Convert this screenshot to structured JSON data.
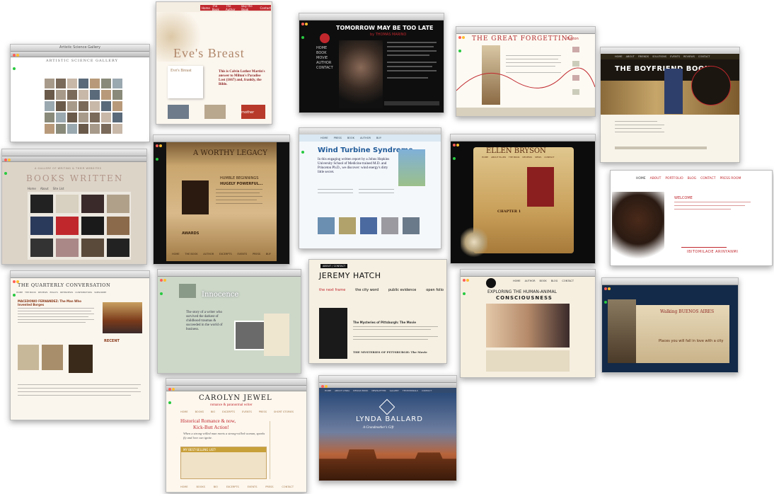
{
  "shots": {
    "s01": {
      "title": "Artistic Science Gallery",
      "heading": "ARTISTIC SCIENCE GALLERY"
    },
    "s02": {
      "brand": "Eve's Breast",
      "book_label": "Eve's Breast",
      "tagline": "This is Calvin Luther Martin's answer to Milton's Paradise Lost (1667) and, frankly, the Bible.",
      "nav": [
        "Home",
        "The Book",
        "The Author",
        "Buy the Book",
        "Contact"
      ],
      "mother": "mother"
    },
    "s03": {
      "title": "TOMORROW MAY BE TOO LATE",
      "sub": "by THOMAS MARINO",
      "side_items": [
        "HOME",
        "BOOK",
        "MOVIE",
        "AUTHOR",
        "CONTACT"
      ]
    },
    "s04": {
      "title": "THE GREAT FORGETTING",
      "nav_btn": "Button"
    },
    "s05": {
      "title": "THE BOYFRIEND BOOK",
      "nav": [
        "HOME",
        "ABOUT",
        "FRIENDS",
        "SOLUTIONS",
        "EVENTS",
        "REVIEWS",
        "CONTACT"
      ]
    },
    "s06": {
      "heading": "BOOKS WRITTEN",
      "subheading": "A GALLERY OF WRITING & THEIR WEBSITES",
      "tabs": [
        "Home",
        "About",
        "Site List"
      ]
    },
    "s07": {
      "heading": "A WORTHY LEGACY",
      "line1": "HUMBLE BEGINNINGS",
      "line2": "HUGELY POWERFUL...",
      "awards": "AWARDS",
      "nav": [
        "HOME",
        "THE BOOK",
        "AUTHOR",
        "EXCERPTS",
        "EVENTS",
        "PRESS",
        "BUY"
      ]
    },
    "s08": {
      "title": "Wind Turbine Syndrome",
      "quote": "In this engaging written report by a Johns Hopkins University School of Medicine trained M.D. and Princeton Ph.D., we discover: wind energy's dirty little secret.",
      "nav": [
        "HOME",
        "PRESS",
        "BOOK",
        "AUTHOR",
        "BUY"
      ]
    },
    "s09": {
      "title": "ELLEN BRYSON",
      "chapter": "CHAPTER 1",
      "nav": [
        "HOME",
        "ABOUT ELLEN",
        "THE BOOK",
        "REVIEWS",
        "NEWS",
        "CONTACT"
      ]
    },
    "s10": {
      "nav": [
        "HOME",
        "ABOUT",
        "PORTFOLIO",
        "BLOG",
        "CONTACT",
        "PRESS ROOM"
      ],
      "name": "IBITOMILADE ARINYANMI",
      "welcome": "WELCOME"
    },
    "s11": {
      "heading": "THE QUARTERLY CONVERSATION",
      "article": "MACEDONIO FERNANDEZ: The Man Who Invented Borges",
      "nav": [
        "HOME",
        "THE BOOK",
        "REVIEWS",
        "ESSAYS",
        "INTERVIEWS",
        "CONTRIBUTORS",
        "SUBSCRIBE"
      ],
      "side": "RECENT"
    },
    "s12": {
      "heading": "Innocence",
      "quote": "The story of a writer who survived the darkest of childhood traumas & succeeded in the world of business."
    },
    "s13": {
      "name": "JEREMY HATCH",
      "tag": "ABOUT / CONTACT",
      "links": [
        "the next frame",
        "the city word",
        "public evidence",
        "open folio"
      ],
      "heading1": "The Mysteries of Pittsburgh: The Movie",
      "heading2": "THE MYSTERIES OF PITTSBURGH: The Movie"
    },
    "s14": {
      "title1": "EXPLORING THE HUMAN-ANIMAL",
      "title2": "CONSCIOUSNESS",
      "nav": [
        "HOME",
        "AUTHOR",
        "BOOK",
        "BLOG",
        "CONTACT"
      ]
    },
    "s15": {
      "heading": "Walking BUENOS AIRES",
      "sub": "Places you will fall in love with a city"
    },
    "s16": {
      "name": "CAROLYN JEWEL",
      "tagline": "romance & paranormal writer",
      "nav": [
        "HOME",
        "BOOKS",
        "BIO",
        "EXCERPTS",
        "EVENTS",
        "PRESS",
        "SHORT STORIES"
      ],
      "promo1": "Historical Romance & now,",
      "promo2": "Kick-Butt Action!",
      "promo3": "When a strong-willed man meets a strong-willed woman, sparks fly and love can ignite.",
      "news": "MY BEST-SELLING LIST!",
      "footer": [
        "HOME",
        "BOOKS",
        "BIO",
        "EXCERPTS",
        "EVENTS",
        "PRESS",
        "CONTACT"
      ]
    },
    "s17": {
      "title": "LYNDA BALLARD",
      "sub": "A Grandmother's Gift",
      "nav": [
        "HOME",
        "ABOUT LYNDA",
        "DESIGN BOOK",
        "NEWSLETTER",
        "GALLERY",
        "TESTIMONIALS",
        "CONTACT"
      ]
    }
  },
  "colors": {
    "red": "#c0272d",
    "gold": "#a5794a",
    "dark": "#151515"
  }
}
